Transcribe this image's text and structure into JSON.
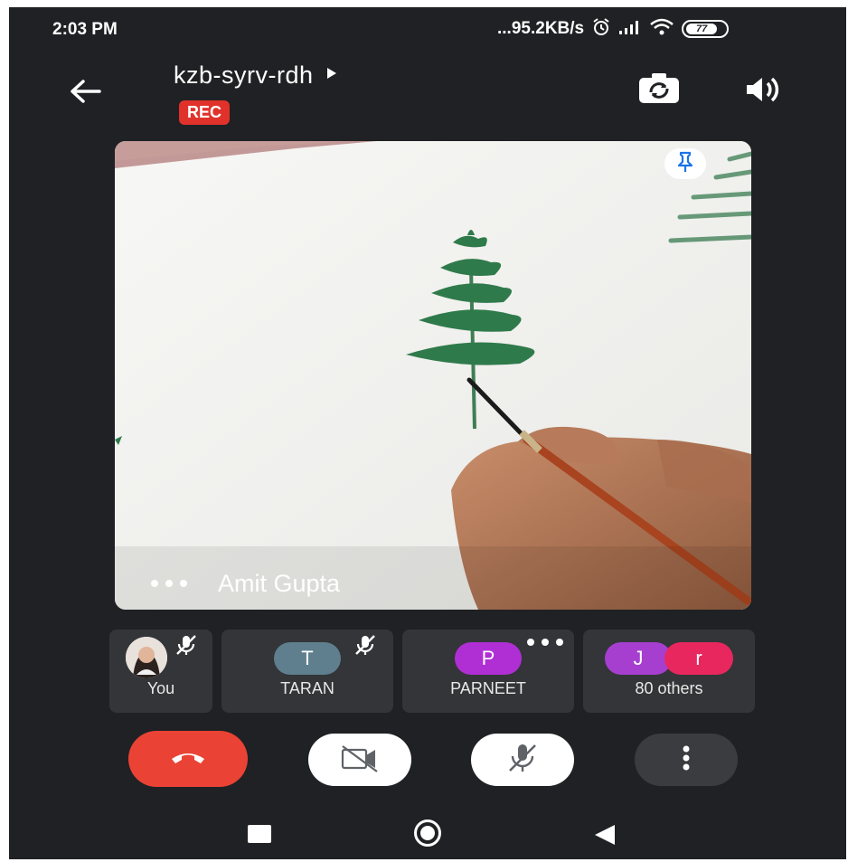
{
  "status_bar": {
    "time": "2:03 PM",
    "network_speed": "...95.2KB/s",
    "battery": "77",
    "icons": [
      "alarm-icon",
      "signal-icon",
      "wifi-icon",
      "battery-icon"
    ]
  },
  "header": {
    "meeting_code": "kzb-syrv-rdh",
    "rec_label": "REC",
    "back_icon": "arrow-left-icon",
    "switch_camera_icon": "camera-switch-icon",
    "speaker_icon": "speaker-icon"
  },
  "main_video": {
    "speaker_name": "Amit Gupta",
    "pin_icon": "pin-icon"
  },
  "participants": [
    {
      "name": "You",
      "muted": true
    },
    {
      "name": "TARAN",
      "initial": "T",
      "color": "#5f7f8e",
      "muted": true
    },
    {
      "name": "PARNEET",
      "initial": "P",
      "color": "#b02fd4",
      "more": true
    },
    {
      "name": "80 others",
      "initials": [
        "J",
        "r"
      ],
      "colors": [
        "#a63fd0",
        "#e8275f"
      ]
    }
  ],
  "controls": {
    "end_call_color": "#ea4335",
    "icons": [
      "end-call-icon",
      "camera-off-icon",
      "mic-off-icon",
      "more-options-icon"
    ]
  },
  "nav_bar": {
    "icons": [
      "recents-icon",
      "home-icon",
      "back-icon"
    ]
  }
}
